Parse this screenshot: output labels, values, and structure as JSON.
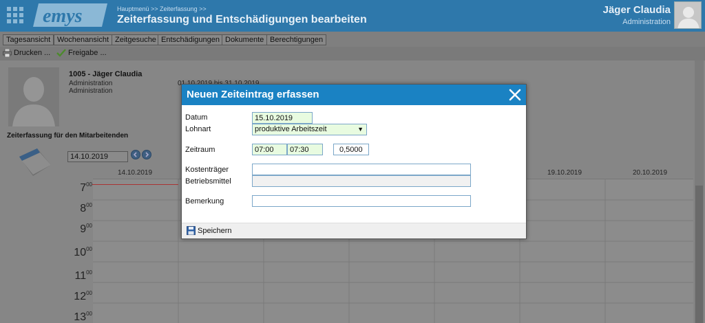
{
  "header": {
    "breadcrumb": "Hauptmenü >> Zeiterfassung >>",
    "title": "Zeiterfassung und Entschädigungen bearbeiten",
    "user_name": "Jäger Claudia",
    "user_role": "Administration",
    "logo_text": "emys"
  },
  "tabs": [
    {
      "label": "Tagesansicht"
    },
    {
      "label": "Wochenansicht"
    },
    {
      "label": "Zeitgesuche"
    },
    {
      "label": "Entschädigungen"
    },
    {
      "label": "Dokumente"
    },
    {
      "label": "Berechtigungen"
    }
  ],
  "toolbar": {
    "print_label": "Drucken ...",
    "release_label": "Freigabe ..."
  },
  "employee": {
    "name": "1005 - Jäger Claudia",
    "line1": "Administration",
    "line2": "Administration",
    "period": "01.10.2019 bis 31.10.2019"
  },
  "calendar": {
    "section_title": "Zeiterfassung für den Mitarbeitenden",
    "date_value": "14.10.2019",
    "days": [
      "14.10.2019",
      "19.10.2019",
      "20.10.2019"
    ],
    "hours": [
      "7",
      "8",
      "9",
      "10",
      "11",
      "12",
      "13"
    ],
    "minutes_suffix": "00"
  },
  "modal": {
    "title": "Neuen Zeiteintrag erfassen",
    "datum_label": "Datum",
    "datum_value": "15.10.2019",
    "lohnart_label": "Lohnart",
    "lohnart_value": "produktive Arbeitszeit",
    "zeitraum_label": "Zeitraum",
    "zeit_von": "07:00",
    "zeit_bis": "07:30",
    "dauer": "0,5000",
    "kostentraeger_label": "Kostenträger",
    "kostentraeger_value": "",
    "betriebsmittel_label": "Betriebsmittel",
    "betriebsmittel_value": "",
    "bemerkung_label": "Bemerkung",
    "bemerkung_value": "",
    "save_label": "Speichern"
  },
  "colors": {
    "header_bg": "#2e78ab",
    "modal_header_bg": "#1a82c3",
    "input_green": "#e8fbe0"
  }
}
